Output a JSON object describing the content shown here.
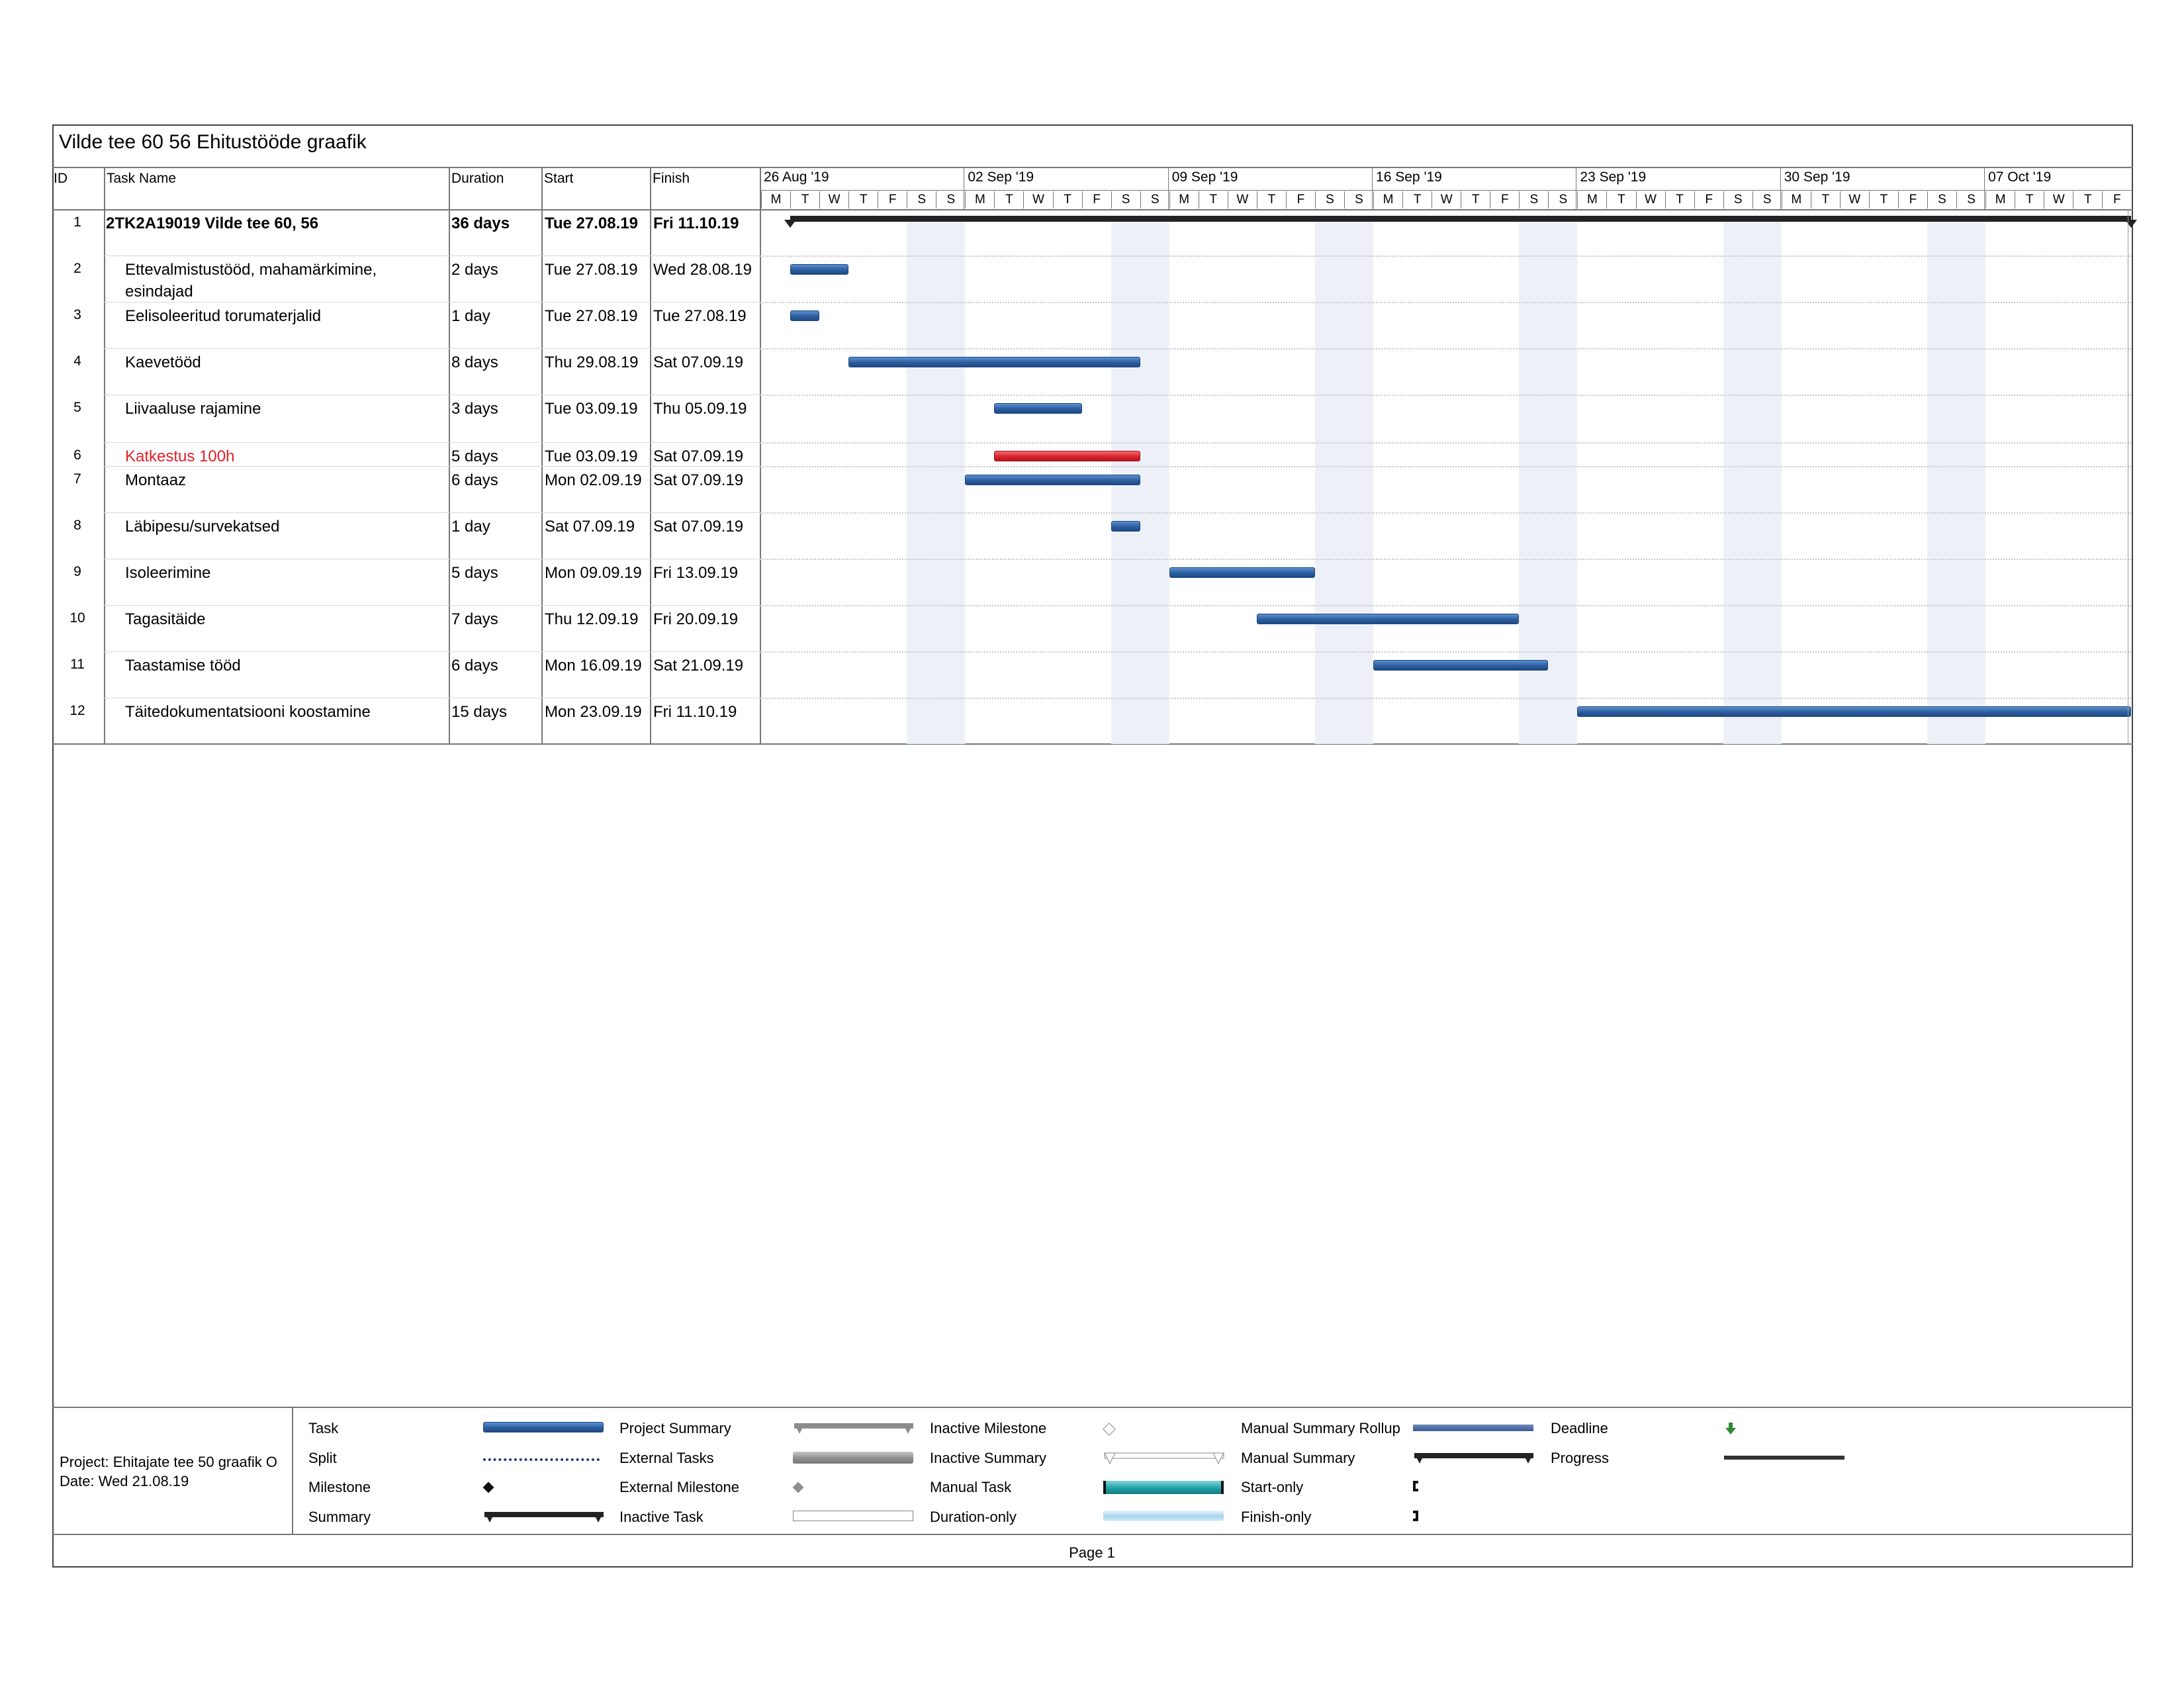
{
  "title": "Vilde tee 60 56 Ehitustööde graafik",
  "columns": {
    "id": "ID",
    "name": "Task Name",
    "duration": "Duration",
    "start": "Start",
    "finish": "Finish"
  },
  "timescale": {
    "weeks": [
      "26 Aug '19",
      "02 Sep '19",
      "09 Sep '19",
      "16 Sep '19",
      "23 Sep '19",
      "30 Sep '19",
      "07 Oct '19"
    ],
    "days": [
      "M",
      "T",
      "W",
      "T",
      "F",
      "S",
      "S"
    ],
    "last_week_days": [
      "M",
      "T",
      "W",
      "T",
      "F"
    ]
  },
  "tasks": [
    {
      "id": "1",
      "name": "2TK2A19019 Vilde tee 60, 56",
      "duration": "36 days",
      "start": "Tue 27.08.19",
      "finish": "Fri 11.10.19",
      "type": "summary"
    },
    {
      "id": "2",
      "name": "Ettevalmistustööd, mahamärkimine,",
      "name2": "esindajad",
      "duration": "2 days",
      "start": "Tue 27.08.19",
      "finish": "Wed 28.08.19",
      "type": "task"
    },
    {
      "id": "3",
      "name": "Eelisoleeritud torumaterjalid",
      "duration": "1 day",
      "start": "Tue 27.08.19",
      "finish": "Tue 27.08.19",
      "type": "task"
    },
    {
      "id": "4",
      "name": "Kaevetööd",
      "duration": "8 days",
      "start": "Thu 29.08.19",
      "finish": "Sat 07.09.19",
      "type": "task"
    },
    {
      "id": "5",
      "name": "Liivaaluse rajamine",
      "duration": "3 days",
      "start": "Tue 03.09.19",
      "finish": "Thu 05.09.19",
      "type": "task"
    },
    {
      "id": "6",
      "name": "Katkestus 100h",
      "duration": "5 days",
      "start": "Tue 03.09.19",
      "finish": "Sat 07.09.19",
      "type": "critical"
    },
    {
      "id": "7",
      "name": "Montaaz",
      "duration": "6 days",
      "start": "Mon 02.09.19",
      "finish": "Sat 07.09.19",
      "type": "task"
    },
    {
      "id": "8",
      "name": "Läbipesu/survekatsed",
      "duration": "1 day",
      "start": "Sat 07.09.19",
      "finish": "Sat 07.09.19",
      "type": "task"
    },
    {
      "id": "9",
      "name": "Isoleerimine",
      "duration": "5 days",
      "start": "Mon 09.09.19",
      "finish": "Fri 13.09.19",
      "type": "task"
    },
    {
      "id": "10",
      "name": "Tagasitäide",
      "duration": "7 days",
      "start": "Thu 12.09.19",
      "finish": "Fri 20.09.19",
      "type": "task"
    },
    {
      "id": "11",
      "name": "Taastamise tööd",
      "duration": "6 days",
      "start": "Mon 16.09.19",
      "finish": "Sat 21.09.19",
      "type": "task"
    },
    {
      "id": "12",
      "name": "Täitedokumentatsiooni koostamine",
      "duration": "15 days",
      "start": "Mon 23.09.19",
      "finish": "Fri 11.10.19",
      "type": "task"
    }
  ],
  "legend": {
    "project": "Project: Ehitajate tee 50 graafik O",
    "date": "Date: Wed 21.08.19",
    "items": [
      "Task",
      "Split",
      "Milestone",
      "Summary",
      "Project Summary",
      "External Tasks",
      "External Milestone",
      "Inactive Task",
      "Inactive Milestone",
      "Inactive Summary",
      "Manual Task",
      "Duration-only",
      "Manual Summary Rollup",
      "Manual Summary",
      "Start-only",
      "Finish-only",
      "Deadline",
      "Progress"
    ]
  },
  "page_label": "Page 1",
  "colors": {
    "task": "#2d5e9e",
    "critical": "#d9232d",
    "weekend": "#edf1f7",
    "summary": "#222222",
    "manual_task": "#1fa3a8",
    "deadline": "#2f8a2f"
  }
}
